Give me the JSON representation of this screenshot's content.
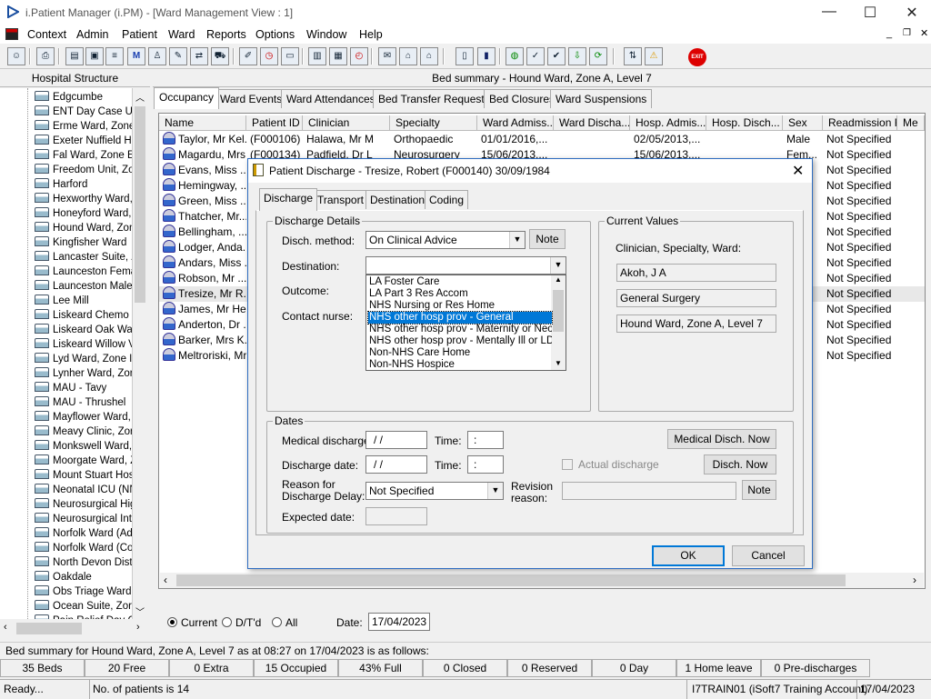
{
  "window": {
    "title": "i.Patient Manager (i.PM) - [Ward Management View : 1]",
    "minimize": "—",
    "maximize": "☐",
    "close": "✕"
  },
  "menu": [
    "Context",
    "Admin",
    "Patient",
    "Ward",
    "Reports",
    "Options",
    "Window",
    "Help"
  ],
  "left_panel": {
    "title": "Hospital Structure",
    "wards": [
      "Edgcumbe",
      "ENT Day Case U",
      "Erme Ward, Zone",
      "Exeter Nuffield H",
      "Fal Ward, Zone E",
      "Freedom Unit, Zo",
      "Harford",
      "Hexworthy Ward,",
      "Honeyford Ward,",
      "Hound Ward, Zon",
      "Kingfisher Ward",
      "Lancaster Suite, Z",
      "Launceston Fema",
      "Launceston Male",
      "Lee Mill",
      "Liskeard Chemo D",
      "Liskeard Oak Wa",
      "Liskeard Willow V",
      "Lyd Ward, Zone I",
      "Lynher Ward, Zor",
      "MAU - Tavy",
      "MAU - Thrushel",
      "Mayflower Ward,",
      "Meavy Clinic, Zor",
      "Monkswell Ward,",
      "Moorgate Ward, Z",
      "Mount Stuart Hos",
      "Neonatal ICU (NN",
      "Neurosurgical Hig",
      "Neurosurgical Inte",
      "Norfolk Ward (Ad",
      "Norfolk Ward (Co",
      "North Devon Dist",
      "Oakdale",
      "Obs Triage Ward",
      "Ocean Suite, Zor",
      "Pain Relief Day C"
    ]
  },
  "right_panel": {
    "title": "Bed summary - Hound Ward, Zone A, Level 7",
    "tabs": [
      "Occupancy",
      "Ward Events",
      "Ward Attendances",
      "Bed Transfer Requests",
      "Bed Closures",
      "Ward Suspensions"
    ],
    "columns": [
      "Name",
      "Patient ID",
      "Clinician",
      "Specialty",
      "Ward Admiss...",
      "Ward Discha...",
      "Hosp. Admis...",
      "Hosp. Disch...",
      "Sex",
      "Readmission R...",
      "Me"
    ],
    "rows": [
      {
        "name": "Taylor, Mr Kel...",
        "id": "(F000106)",
        "clinician": "Halawa, Mr M",
        "specialty": "Orthopaedic",
        "ward_adm": "01/01/2016,...",
        "hosp_adm": "02/05/2013,...",
        "sex": "Male",
        "readm": "Not Specified"
      },
      {
        "name": "Magardu, Mrs...",
        "id": "(F000134)",
        "clinician": "Padfield, Dr L",
        "specialty": "Neurosurgery",
        "ward_adm": "15/06/2013,...",
        "hosp_adm": "15/06/2013,...",
        "sex": "Fem...",
        "readm": "Not Specified"
      },
      {
        "name": "Evans, Miss ...",
        "readm": "Not Specified"
      },
      {
        "name": "Hemingway, ...",
        "readm": "Not Specified"
      },
      {
        "name": "Green, Miss ...",
        "readm": "Not Specified"
      },
      {
        "name": "Thatcher, Mr...",
        "readm": "Not Specified"
      },
      {
        "name": "Bellingham, ...",
        "readm": "Not Specified"
      },
      {
        "name": "Lodger, Anda...",
        "readm": "Not Specified"
      },
      {
        "name": "Andars, Miss ...",
        "readm": "Not Specified"
      },
      {
        "name": "Robson, Mr ...",
        "readm": "Not Specified"
      },
      {
        "name": "Tresize, Mr R...",
        "readm": "Not Specified"
      },
      {
        "name": "James, Mr He...",
        "readm": "Not Specified"
      },
      {
        "name": "Anderton, Dr ...",
        "readm": "Not Specified"
      },
      {
        "name": "Barker, Mrs K...",
        "readm": "Not Specified"
      },
      {
        "name": "Meltroriski, Mr...",
        "readm": "Not Specified"
      }
    ],
    "filter": {
      "current": "Current",
      "dtd": "D/T'd",
      "all": "All",
      "date_label": "Date:",
      "date": "17/04/2023"
    }
  },
  "dialog": {
    "title": "Patient Discharge - Tresize, Robert (F000140) 30/09/1984",
    "tabs": [
      "Discharge",
      "Transport",
      "Destination",
      "Coding"
    ],
    "discharge_details": {
      "legend": "Discharge Details",
      "method_label": "Disch. method:",
      "method_value": "On Clinical Advice",
      "note": "Note",
      "destination_label": "Destination:",
      "outcome_label": "Outcome:",
      "contact_label": "Contact nurse:",
      "destination_options": [
        "LA Foster Care",
        "LA Part 3 Res Accom",
        "NHS Nursing or Res Home",
        "NHS other hosp prov - General",
        "NHS other hosp prov - Maternity or Neona",
        "NHS other hosp prov - Mentally Ill or LDS",
        "Non-NHS Care Home",
        "Non-NHS Hospice"
      ],
      "selected_option": "NHS other hosp prov - General"
    },
    "current_values": {
      "legend": "Current Values",
      "caption": "Clinician, Specialty, Ward:",
      "clinician": "Akoh, J A",
      "specialty": "General Surgery",
      "ward": "Hound Ward, Zone A, Level 7"
    },
    "dates": {
      "legend": "Dates",
      "medical_label": "Medical discharge:",
      "medical_value": "/ /",
      "time_label": "Time:",
      "time_value": ":",
      "medical_now": "Medical Disch. Now",
      "discharge_label": "Discharge date:",
      "discharge_value": "/ /",
      "actual_label": "Actual discharge",
      "disch_now": "Disch. Now",
      "delay_label_1": "Reason for",
      "delay_label_2": "Discharge Delay:",
      "delay_value": "Not Specified",
      "revision_label_1": "Revision",
      "revision_label_2": "reason:",
      "revision_note": "Note",
      "expected_label": "Expected date:"
    },
    "ok": "OK",
    "cancel": "Cancel"
  },
  "status": {
    "summary": "Bed summary for Hound Ward, Zone A, Level 7 as at 08:27 on 17/04/2023 is as follows:",
    "cells": [
      "35 Beds",
      "20 Free",
      "0 Extra",
      "15 Occupied",
      "43% Full",
      "0 Closed",
      "0 Reserved",
      "0 Day",
      "1 Home leave",
      "0 Pre-discharges"
    ],
    "ready": "Ready...",
    "patients": "No. of patients is 14",
    "account": "I7TRAIN01 (iSoft7 Training Account)",
    "date": "17/04/2023"
  }
}
